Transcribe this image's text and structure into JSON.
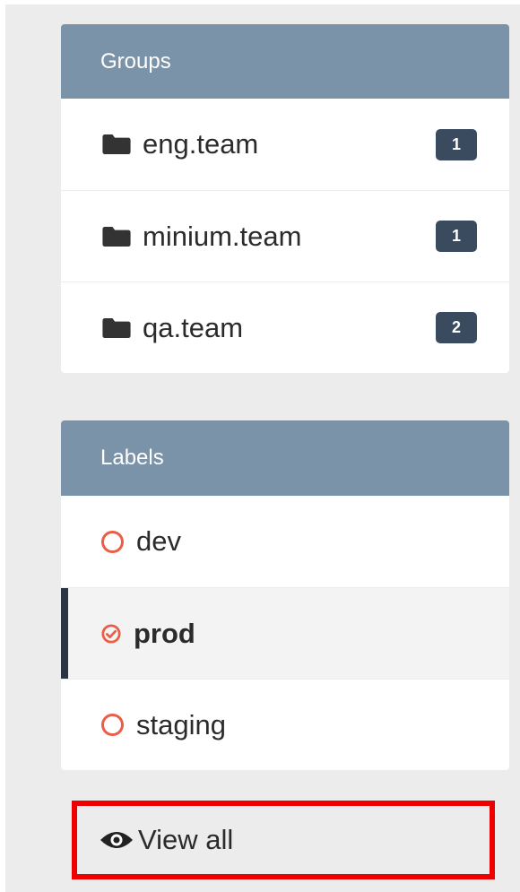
{
  "groups": {
    "title": "Groups",
    "items": [
      {
        "name": "eng.team",
        "count": "1"
      },
      {
        "name": "minium.team",
        "count": "1"
      },
      {
        "name": "qa.team",
        "count": "2"
      }
    ]
  },
  "labels": {
    "title": "Labels",
    "items": [
      {
        "name": "dev",
        "selected": false
      },
      {
        "name": "prod",
        "selected": true
      },
      {
        "name": "staging",
        "selected": false
      }
    ]
  },
  "view_all": {
    "label": "View all",
    "icon": "eye-icon"
  },
  "colors": {
    "header": "#7b93a8",
    "badge": "#3a4a5f",
    "label_ring": "#ec5d45",
    "active_bar": "#2a3544",
    "highlight": "#ee0000"
  },
  "icons": {
    "group": "folder-icon",
    "label": "circle-icon",
    "label_selected": "check-circle-icon"
  }
}
